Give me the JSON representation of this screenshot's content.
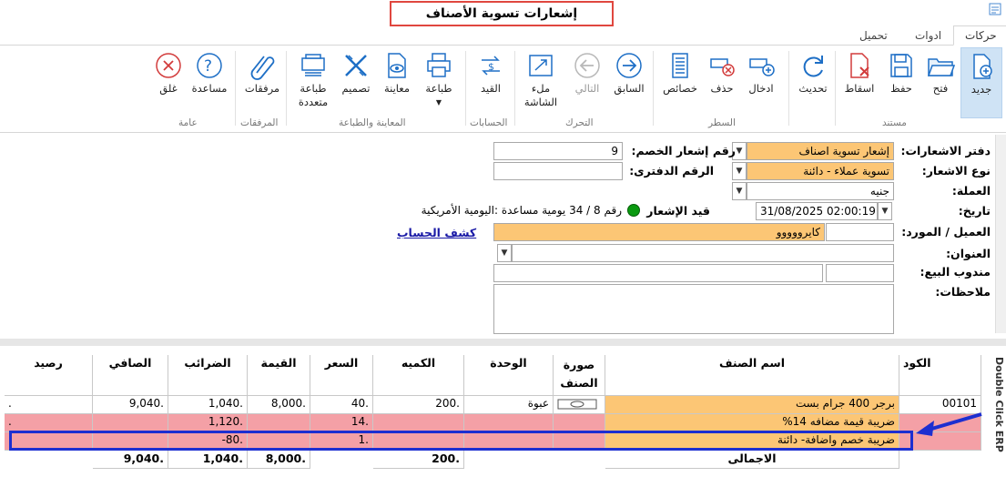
{
  "window": {
    "title": "إشعارات تسوية الأصناف"
  },
  "tabs": [
    {
      "label": "حركات"
    },
    {
      "label": "ادوات"
    },
    {
      "label": "تحميل"
    }
  ],
  "ribbon": {
    "buttons": [
      {
        "label": "جديد",
        "icon": "new-doc-icon"
      },
      {
        "label": "فتح",
        "icon": "folder-open-icon"
      },
      {
        "label": "حفظ",
        "icon": "save-icon"
      },
      {
        "label": "اسقاط",
        "icon": "delete-doc-icon"
      },
      {
        "label": "تحديث",
        "icon": "refresh-icon"
      },
      {
        "label": "ادخال",
        "icon": "insert-line-icon"
      },
      {
        "label": "حذف",
        "icon": "delete-line-icon"
      },
      {
        "label": "خصائص",
        "icon": "properties-icon"
      },
      {
        "label": "السابق",
        "icon": "arrow-right-icon"
      },
      {
        "label": "التالي",
        "icon": "arrow-left-icon"
      },
      {
        "label": "ملء الشاشة",
        "icon": "fullscreen-icon"
      },
      {
        "label": "القيد",
        "icon": "journal-icon"
      },
      {
        "label": "طباعة",
        "icon": "printer-icon"
      },
      {
        "label": "معاينة",
        "icon": "preview-icon"
      },
      {
        "label": "تصميم",
        "icon": "design-icon"
      },
      {
        "label": "طباعة متعددة",
        "icon": "multi-print-icon"
      },
      {
        "label": "مرفقات",
        "icon": "attachment-icon"
      },
      {
        "label": "مساعدة",
        "icon": "help-icon"
      },
      {
        "label": "غلق",
        "icon": "close-icon"
      }
    ],
    "groups": [
      "مستند",
      "السطر",
      "التحرك",
      "الحسابات",
      "المعاينة والطباعة",
      "المرفقات",
      "عامة"
    ]
  },
  "form": {
    "notebook_label": "دفتر الاشعارات:",
    "notebook_value": "إشعار تسوية اصناف",
    "type_label": "نوع الاشعار:",
    "type_value": "تسوية عملاء - دائنة",
    "currency_label": "العملة:",
    "currency_value": "جنيه",
    "date_label": "تاريخ:",
    "date_value": "31/08/2025 02:00:19 PM",
    "customer_label": "العميل / المورد:",
    "customer_value": "كايرووووو",
    "address_label": "العنوان:",
    "salesrep_label": "مندوب البيع:",
    "notes_label": "ملاحظات:",
    "discount_no_label": "رقم إشعار الخصم:",
    "discount_no_value": "9",
    "book_no_label": "الرقم الدفترى:",
    "entry_label": "قيد الإشعار",
    "entry_value": "رقم 8 / 34 يومية مساعدة :اليومية الأمريكية",
    "statement_link": "كشف الحساب"
  },
  "grid": {
    "headers": {
      "code": "الكود",
      "name": "اسم الصنف",
      "image": "صورة الصنف",
      "unit": "الوحدة",
      "qty": "الكميه",
      "price": "السعر",
      "value": "القيمة",
      "taxes": "الضرائب",
      "net": "الصافي",
      "balance": "رصيد"
    },
    "rows": [
      {
        "code": "00101",
        "name": "برجر 400 جرام بست",
        "unit": "عبوة",
        "qty": "200.",
        "price": "40.",
        "value": "8,000.",
        "taxes": "1,040.",
        "net": "9,040.",
        "balance": "."
      },
      {
        "code": "",
        "name": "ضريبة قيمة مضافه 14%",
        "unit": "",
        "qty": "",
        "price": "14.",
        "value": "",
        "taxes": "1,120.",
        "net": "",
        "balance": "."
      },
      {
        "code": "",
        "name": "ضريبة خصم واضافة- دائنة",
        "unit": "",
        "qty": "",
        "price": "1.",
        "value": "",
        "taxes": "-80.",
        "net": "",
        "balance": "."
      }
    ],
    "totals": {
      "label": "الاجمالى",
      "qty": "200.",
      "value": "8,000.",
      "taxes": "1,040.",
      "net": "9,040."
    },
    "side_caption": "Double Click ERP"
  },
  "colors": {
    "orange": "#fcc675",
    "pink": "#f4a0a6",
    "highlight": "#1d2fd0",
    "accent": "#1e6fc6"
  }
}
